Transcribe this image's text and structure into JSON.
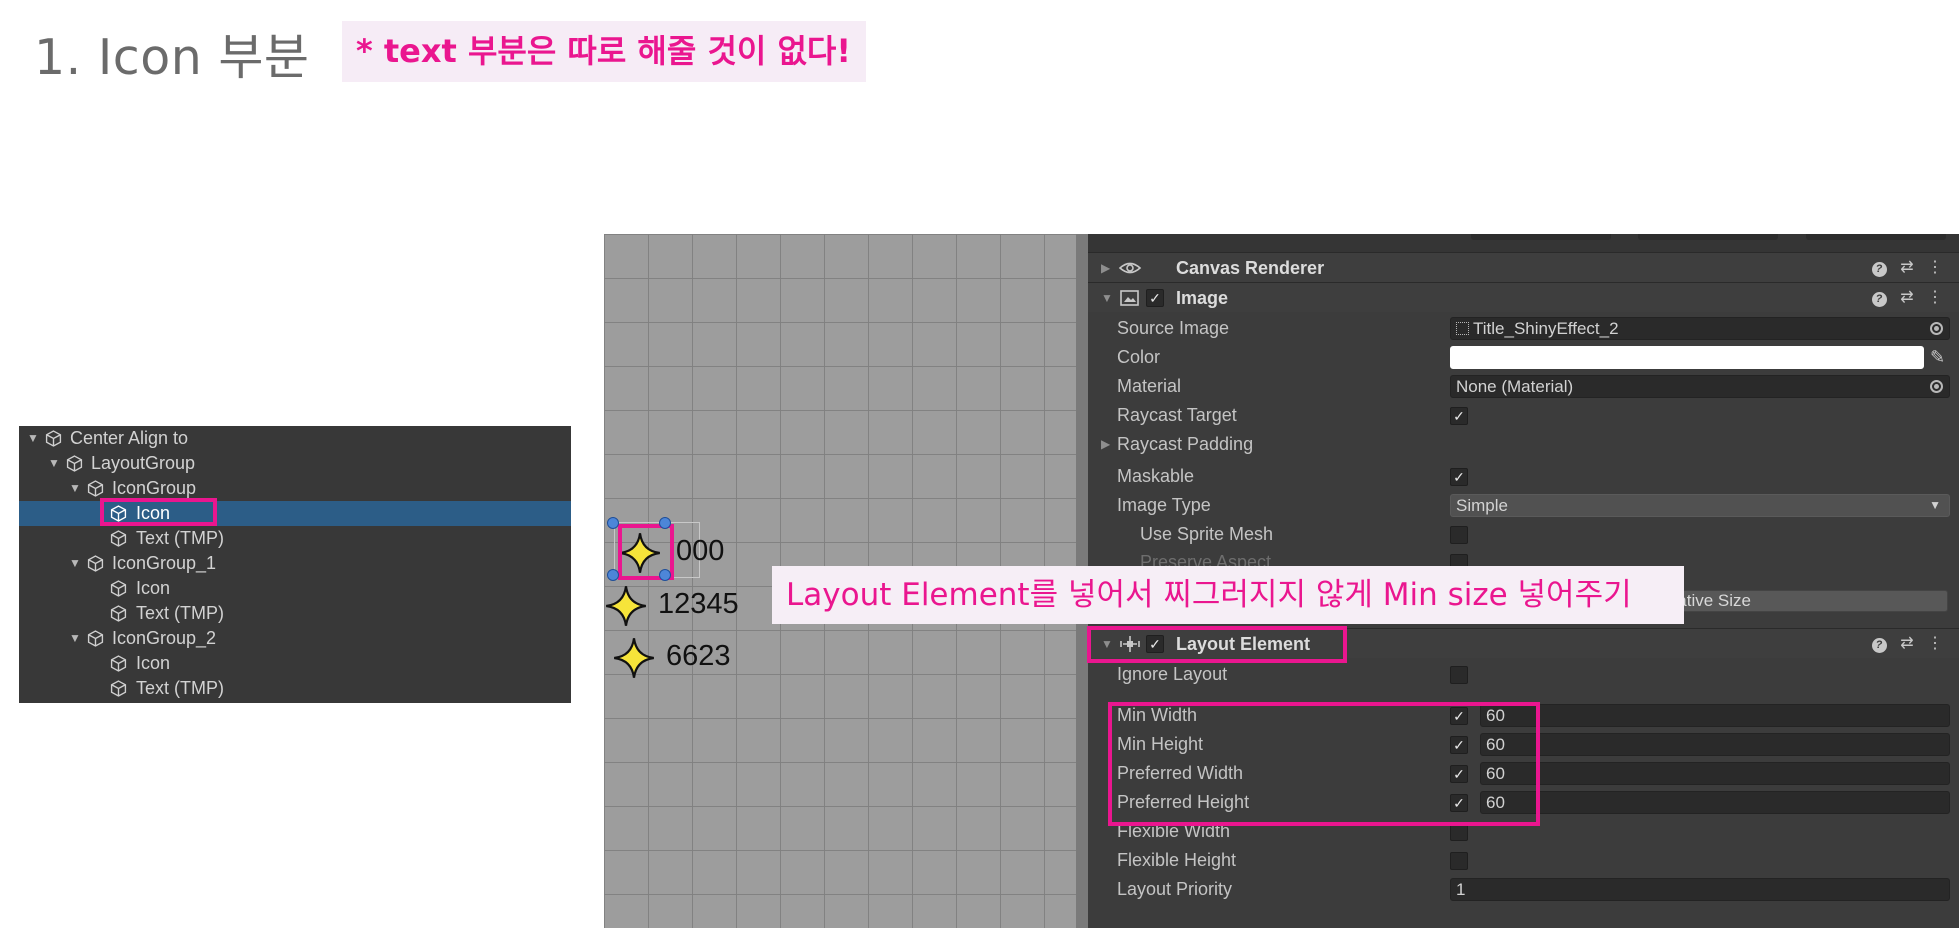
{
  "header": {
    "title": "1. Icon 부분",
    "note": "* text 부분은 따로 해줄 것이 없다!"
  },
  "hierarchy": {
    "items": [
      {
        "label": "Center Align to"
      },
      {
        "label": "LayoutGroup"
      },
      {
        "label": "IconGroup"
      },
      {
        "label": "Icon"
      },
      {
        "label": "Text (TMP)"
      },
      {
        "label": "IconGroup_1"
      },
      {
        "label": "Icon"
      },
      {
        "label": "Text (TMP)"
      },
      {
        "label": "IconGroup_2"
      },
      {
        "label": "Icon"
      },
      {
        "label": "Text (TMP)"
      }
    ]
  },
  "scene": {
    "rows": [
      {
        "value": "000"
      },
      {
        "value": "12345"
      },
      {
        "value": "6623"
      }
    ],
    "star_color": "#f6e43a"
  },
  "inspector": {
    "canvas_renderer": {
      "title": "Canvas Renderer"
    },
    "image": {
      "title": "Image",
      "source_image_label": "Source Image",
      "source_image_value": "Title_ShinyEffect_2",
      "color_label": "Color",
      "material_label": "Material",
      "material_value": "None (Material)",
      "raycast_target_label": "Raycast Target",
      "raycast_padding_label": "Raycast Padding",
      "maskable_label": "Maskable",
      "image_type_label": "Image Type",
      "image_type_value": "Simple",
      "use_sprite_mesh_label": "Use Sprite Mesh",
      "preserve_aspect_label": "Preserve Aspect",
      "set_native_size_label": "Native Size"
    },
    "layout_element": {
      "title": "Layout Element",
      "ignore_layout_label": "Ignore Layout",
      "min_width_label": "Min Width",
      "min_width_value": "60",
      "min_height_label": "Min Height",
      "min_height_value": "60",
      "preferred_width_label": "Preferred Width",
      "preferred_width_value": "60",
      "preferred_height_label": "Preferred Height",
      "preferred_height_value": "60",
      "flexible_width_label": "Flexible Width",
      "flexible_height_label": "Flexible Height",
      "layout_priority_label": "Layout Priority",
      "layout_priority_value": "1"
    }
  },
  "callout": {
    "text": "Layout Element를 넣어서 찌그러지지 않게 Min size 넣어주기"
  },
  "colors": {
    "highlight": "#ea168f",
    "selection": "#2c5d87"
  }
}
